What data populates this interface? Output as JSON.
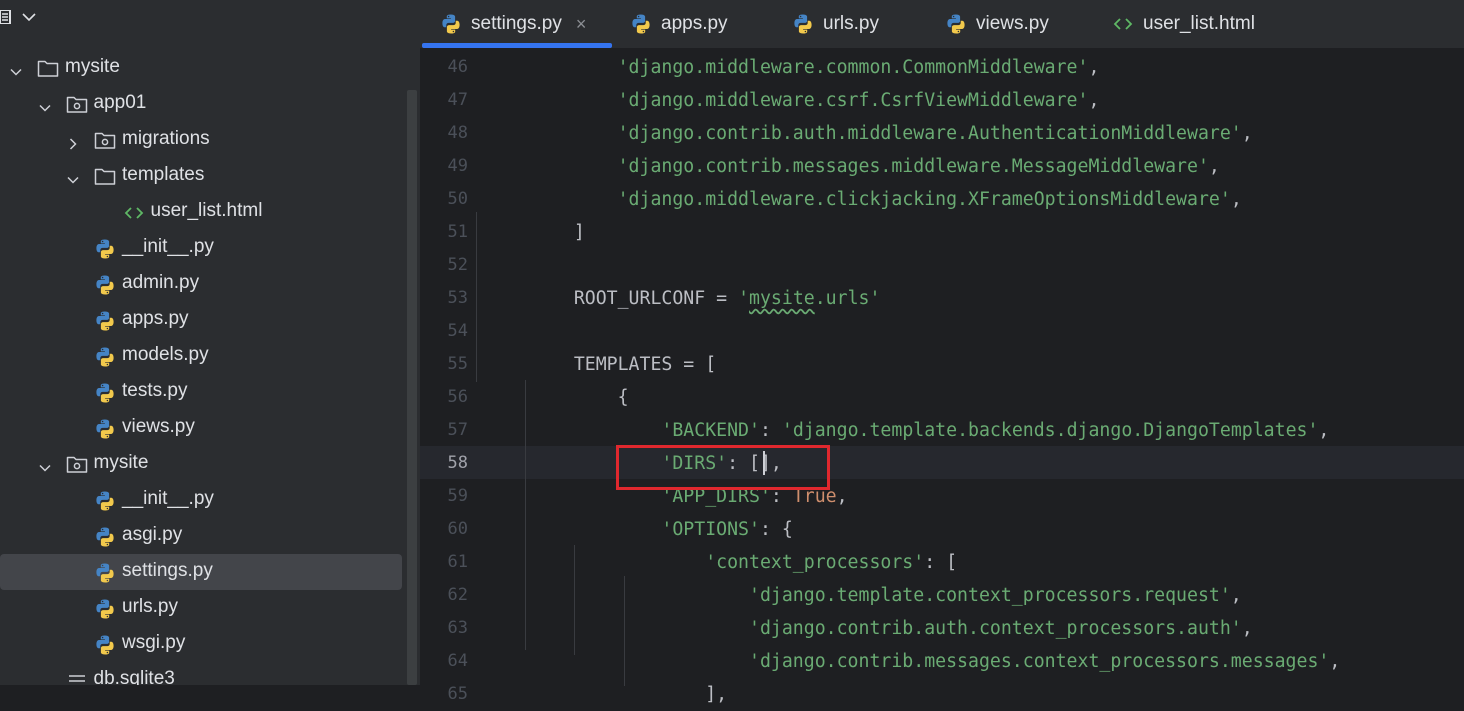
{
  "sidebar": {
    "tree": [
      {
        "label": "mysite",
        "kind": "folder",
        "level": 0,
        "expanded": true
      },
      {
        "label": "app01",
        "kind": "package",
        "level": 1,
        "expanded": true
      },
      {
        "label": "migrations",
        "kind": "package",
        "level": 2,
        "expanded": false
      },
      {
        "label": "templates",
        "kind": "folder",
        "level": 2,
        "expanded": true
      },
      {
        "label": "user_list.html",
        "kind": "html",
        "level": 3
      },
      {
        "label": "__init__.py",
        "kind": "python",
        "level": 2
      },
      {
        "label": "admin.py",
        "kind": "python",
        "level": 2
      },
      {
        "label": "apps.py",
        "kind": "python",
        "level": 2
      },
      {
        "label": "models.py",
        "kind": "python",
        "level": 2
      },
      {
        "label": "tests.py",
        "kind": "python",
        "level": 2
      },
      {
        "label": "views.py",
        "kind": "python",
        "level": 2
      },
      {
        "label": "mysite",
        "kind": "package",
        "level": 1,
        "expanded": true
      },
      {
        "label": "__init__.py",
        "kind": "python",
        "level": 2
      },
      {
        "label": "asgi.py",
        "kind": "python",
        "level": 2
      },
      {
        "label": "settings.py",
        "kind": "python",
        "level": 2,
        "selected": true
      },
      {
        "label": "urls.py",
        "kind": "python",
        "level": 2
      },
      {
        "label": "wsgi.py",
        "kind": "python",
        "level": 2
      },
      {
        "label": "db.sqlite3",
        "kind": "db",
        "level": 1
      }
    ]
  },
  "tabs": [
    {
      "label": "settings.py",
      "kind": "python",
      "active": true,
      "close": "×"
    },
    {
      "label": "apps.py",
      "kind": "python"
    },
    {
      "label": "urls.py",
      "kind": "python"
    },
    {
      "label": "views.py",
      "kind": "python"
    },
    {
      "label": "user_list.html",
      "kind": "html"
    }
  ],
  "editor": {
    "current_line": "58",
    "lines": [
      {
        "n": "46",
        "indent": "        ",
        "s": "'django.middleware.common.CommonMiddleware'",
        "t": ","
      },
      {
        "n": "47",
        "indent": "        ",
        "s": "'django.middleware.csrf.CsrfViewMiddleware'",
        "t": ","
      },
      {
        "n": "48",
        "indent": "        ",
        "s": "'django.contrib.auth.middleware.AuthenticationMiddleware'",
        "t": ","
      },
      {
        "n": "49",
        "indent": "        ",
        "s": "'django.contrib.messages.middleware.MessageMiddleware'",
        "t": ","
      },
      {
        "n": "50",
        "indent": "        ",
        "s": "'django.middleware.clickjacking.XFrameOptionsMiddleware'",
        "t": ","
      },
      {
        "n": "51",
        "indent": "    ",
        "p": "]"
      },
      {
        "n": "52"
      },
      {
        "n": "53",
        "indent": "    ",
        "p": "ROOT_URLCONF = ",
        "s1": "'",
        "sw": "mysite",
        "s2": ".urls'"
      },
      {
        "n": "54"
      },
      {
        "n": "55",
        "indent": "    ",
        "p": "TEMPLATES = ["
      },
      {
        "n": "56",
        "indent": "        ",
        "p": "{"
      },
      {
        "n": "57",
        "indent": "            ",
        "s": "'BACKEND'",
        "t": ": ",
        "s3": "'django.template.backends.django.DjangoTemplates'",
        "t2": ","
      },
      {
        "n": "58",
        "indent": "            ",
        "s": "'DIRS'",
        "t": ": [],"
      },
      {
        "n": "59",
        "indent": "            ",
        "s": "'APP_DIRS'",
        "t": ": ",
        "k": "True",
        "t2": ","
      },
      {
        "n": "60",
        "indent": "            ",
        "s": "'OPTIONS'",
        "t": ": {"
      },
      {
        "n": "61",
        "indent": "                ",
        "s": "'context_processors'",
        "t": ": ["
      },
      {
        "n": "62",
        "indent": "                    ",
        "s": "'django.template.context_processors.request'",
        "t": ","
      },
      {
        "n": "63",
        "indent": "                    ",
        "s": "'django.contrib.auth.context_processors.auth'",
        "t": ","
      },
      {
        "n": "64",
        "indent": "                    ",
        "s": "'django.contrib.messages.context_processors.messages'",
        "t": ","
      },
      {
        "n": "65",
        "indent": "                ",
        "p": "],"
      }
    ]
  },
  "colors": {
    "string": "#6aab73",
    "keyword": "#cf8e6d",
    "text": "#bcbec4",
    "annotation_box": "#e0282e",
    "tab_underline": "#3574f0",
    "python_blue": "#4584c5",
    "python_yellow": "#f2c94c",
    "html_green": "#5fb865"
  },
  "icons": {
    "header_menu": "project-view-icon",
    "header_chevron": "chevron-down-icon"
  }
}
